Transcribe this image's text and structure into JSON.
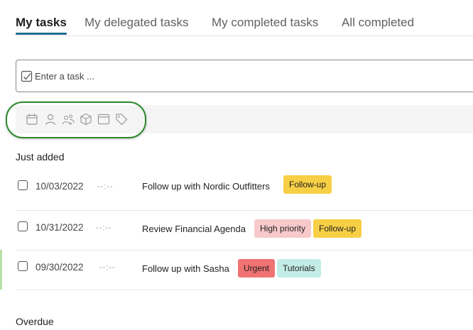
{
  "tabs": [
    {
      "label": "My tasks",
      "active": true
    },
    {
      "label": "My delegated tasks",
      "active": false
    },
    {
      "label": "My completed tasks",
      "active": false
    },
    {
      "label": "All completed",
      "active": false
    }
  ],
  "task_input": {
    "placeholder": "Enter a task ..."
  },
  "toolbar_icons": [
    "calendar-icon",
    "person-icon",
    "people-icon",
    "box-icon",
    "window-icon",
    "tag-icon"
  ],
  "sections": {
    "just_added": "Just added",
    "overdue": "Overdue"
  },
  "tasks": [
    {
      "date": "10/03/2022",
      "time": "--:--",
      "title": "Follow up with Nordic Outfitters",
      "tags": [
        "Follow-up"
      ]
    },
    {
      "date": "10/31/2022",
      "time": "--:--",
      "title": "Review Financial Agenda",
      "tags": [
        "High priority",
        "Follow-up"
      ]
    },
    {
      "date": "09/30/2022",
      "time": "--:--",
      "title": "Follow up with Sasha",
      "tags": [
        "Urgent",
        "Tutorials"
      ]
    }
  ],
  "colors": {
    "accent": "#1f6f8b",
    "follow_up": "#f7cf45",
    "high_priority": "#f7c9cb",
    "urgent": "#f07272",
    "tutorials": "#c4ece7",
    "highlight": "#2e8b2e"
  }
}
